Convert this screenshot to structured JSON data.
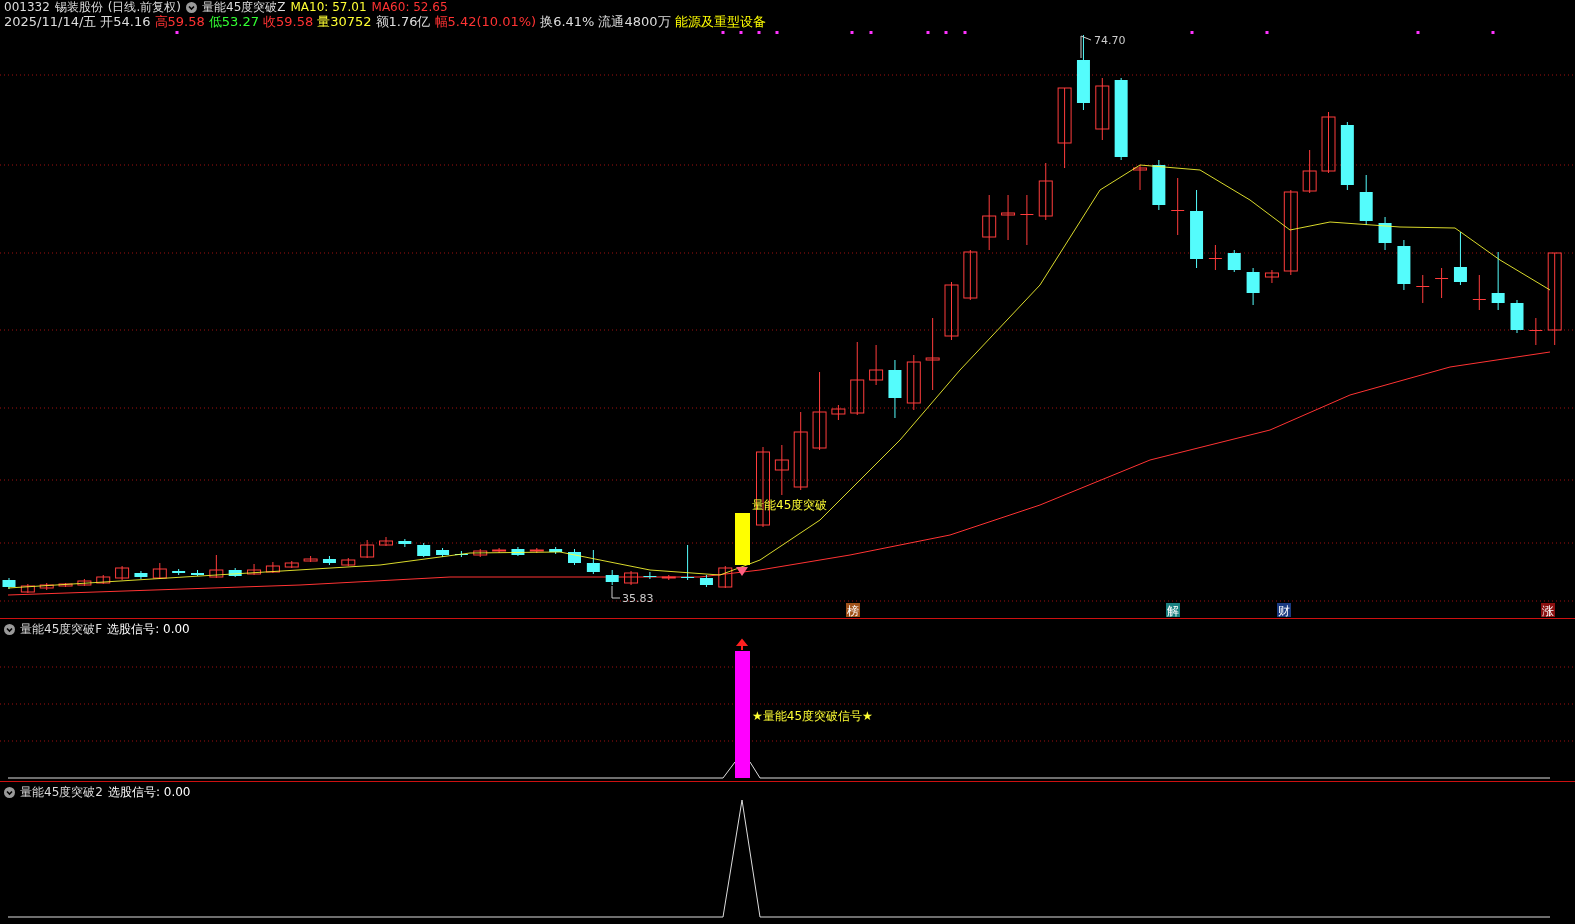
{
  "header": {
    "code": "001332",
    "name": "锡装股份",
    "period": "(日线.前复权)",
    "indicator": "量能45度突破Z",
    "ma": [
      {
        "label": "MA10: 57.01",
        "color": "#ffff33"
      },
      {
        "label": "MA60: 52.65",
        "color": "#ff3333"
      }
    ]
  },
  "quote": [
    {
      "text": "2025/11/14/五",
      "color": "#dddddd"
    },
    {
      "text": "开54.16",
      "color": "#dddddd"
    },
    {
      "text": "高59.58",
      "color": "#ff3333"
    },
    {
      "text": "低53.27",
      "color": "#33ff33"
    },
    {
      "text": "收59.58",
      "color": "#ff3333"
    },
    {
      "text": "量30752",
      "color": "#ffff33"
    },
    {
      "text": "额1.76亿",
      "color": "#dddddd"
    },
    {
      "text": "幅5.42(10.01%)",
      "color": "#ff3333"
    },
    {
      "text": "换6.41%",
      "color": "#dddddd"
    },
    {
      "text": "流通4800万",
      "color": "#dddddd"
    },
    {
      "text": "能源及重型设备",
      "color": "#ffff00"
    }
  ],
  "main_chart": {
    "high_label": "74.70",
    "low_label": "35.83",
    "signal_label": "量能45度突破",
    "events": [
      {
        "text": "榜",
        "color": "#a0521a"
      },
      {
        "text": "解",
        "color": "#1a8080"
      },
      {
        "text": "财",
        "color": "#1a3a80"
      },
      {
        "text": "涨",
        "color": "#8a1010"
      }
    ]
  },
  "panels": [
    {
      "kind": "signal_bar",
      "indicator": "量能45度突破F",
      "reading": "选股信号: 0.00",
      "signal_label": "★量能45度突破信号★"
    },
    {
      "kind": "spike",
      "indicator": "量能45度突破2",
      "reading": "选股信号: 0.00"
    }
  ]
}
